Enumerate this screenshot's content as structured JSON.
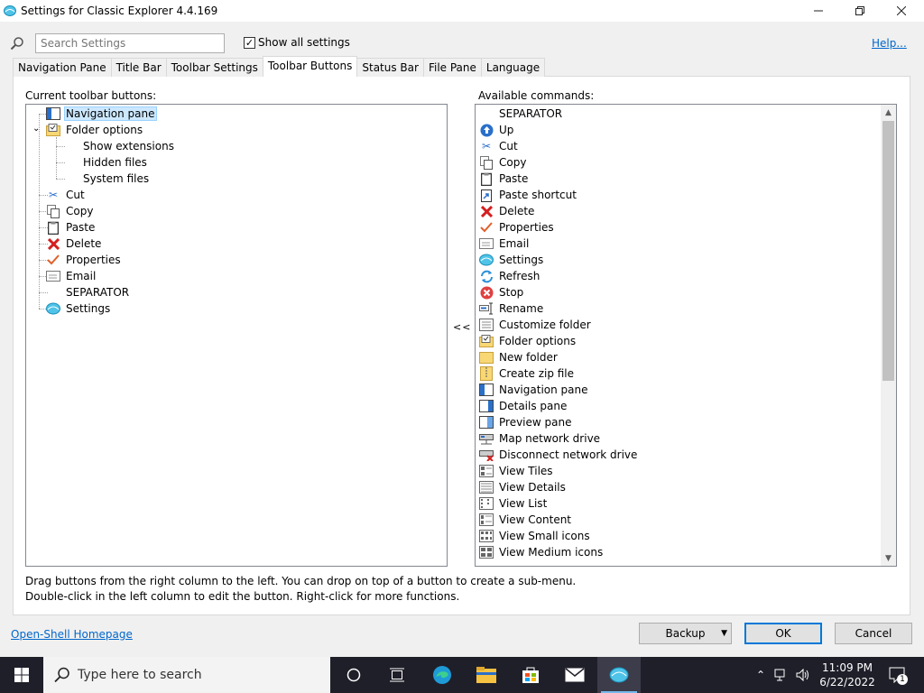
{
  "window": {
    "title": "Settings for Classic Explorer 4.4.169",
    "minimize_icon": "minimize-icon",
    "maximize_icon": "restore-icon",
    "close_icon": "close-icon"
  },
  "search": {
    "placeholder": "Search Settings",
    "value": ""
  },
  "show_all": {
    "label": "Show all settings",
    "checked": true
  },
  "help_link": "Help...",
  "tabs": [
    {
      "label": "Navigation Pane",
      "active": false
    },
    {
      "label": "Title Bar",
      "active": false
    },
    {
      "label": "Toolbar Settings",
      "active": false
    },
    {
      "label": "Toolbar Buttons",
      "active": true
    },
    {
      "label": "Status Bar",
      "active": false
    },
    {
      "label": "File Pane",
      "active": false
    },
    {
      "label": "Language",
      "active": false
    }
  ],
  "left": {
    "label": "Current toolbar buttons:",
    "items": [
      {
        "label": "Navigation pane",
        "icon": "navigation-pane-icon",
        "level": 0,
        "selected": true
      },
      {
        "label": "Folder options",
        "icon": "folder-options-icon",
        "level": 0,
        "expanded": true
      },
      {
        "label": "Show extensions",
        "icon": "",
        "level": 1
      },
      {
        "label": "Hidden files",
        "icon": "",
        "level": 1
      },
      {
        "label": "System files",
        "icon": "",
        "level": 1
      },
      {
        "label": "Cut",
        "icon": "scissors-icon",
        "level": 0
      },
      {
        "label": "Copy",
        "icon": "copy-icon",
        "level": 0
      },
      {
        "label": "Paste",
        "icon": "clipboard-icon",
        "level": 0
      },
      {
        "label": "Delete",
        "icon": "delete-x-icon",
        "level": 0
      },
      {
        "label": "Properties",
        "icon": "checkmark-icon",
        "level": 0
      },
      {
        "label": "Email",
        "icon": "envelope-icon",
        "level": 0
      },
      {
        "label": "SEPARATOR",
        "icon": "",
        "level": 0
      },
      {
        "label": "Settings",
        "icon": "shell-icon",
        "level": 0
      }
    ]
  },
  "move_left": "<<",
  "right": {
    "label": "Available commands:",
    "items": [
      {
        "label": "SEPARATOR",
        "icon": ""
      },
      {
        "label": "Up",
        "icon": "up-arrow-icon"
      },
      {
        "label": "Cut",
        "icon": "scissors-icon"
      },
      {
        "label": "Copy",
        "icon": "copy-icon"
      },
      {
        "label": "Paste",
        "icon": "clipboard-icon"
      },
      {
        "label": "Paste shortcut",
        "icon": "paste-shortcut-icon"
      },
      {
        "label": "Delete",
        "icon": "delete-x-icon"
      },
      {
        "label": "Properties",
        "icon": "checkmark-icon"
      },
      {
        "label": "Email",
        "icon": "envelope-icon"
      },
      {
        "label": "Settings",
        "icon": "shell-icon"
      },
      {
        "label": "Refresh",
        "icon": "refresh-icon"
      },
      {
        "label": "Stop",
        "icon": "stop-icon"
      },
      {
        "label": "Rename",
        "icon": "rename-icon"
      },
      {
        "label": "Customize folder",
        "icon": "customize-folder-icon"
      },
      {
        "label": "Folder options",
        "icon": "folder-options-icon"
      },
      {
        "label": "New folder",
        "icon": "new-folder-icon"
      },
      {
        "label": "Create zip file",
        "icon": "zip-icon"
      },
      {
        "label": "Navigation pane",
        "icon": "navigation-pane-icon"
      },
      {
        "label": "Details pane",
        "icon": "details-pane-icon"
      },
      {
        "label": "Preview pane",
        "icon": "preview-pane-icon"
      },
      {
        "label": "Map network drive",
        "icon": "map-drive-icon"
      },
      {
        "label": "Disconnect network drive",
        "icon": "disconnect-drive-icon"
      },
      {
        "label": "View Tiles",
        "icon": "view-tiles-icon"
      },
      {
        "label": "View Details",
        "icon": "view-details-icon"
      },
      {
        "label": "View List",
        "icon": "view-list-icon"
      },
      {
        "label": "View Content",
        "icon": "view-content-icon"
      },
      {
        "label": "View Small icons",
        "icon": "view-small-icons-icon"
      },
      {
        "label": "View Medium icons",
        "icon": "view-medium-icons-icon"
      }
    ]
  },
  "help_text": {
    "line1": "Drag buttons from the right column to the left. You can drop on top of a button to create a sub-menu.",
    "line2": "Double-click in the left column to edit the button. Right-click for more functions."
  },
  "homepage_link": "Open-Shell Homepage",
  "buttons": {
    "backup": "Backup",
    "ok": "OK",
    "cancel": "Cancel"
  },
  "taskbar": {
    "search_placeholder": "Type here to search",
    "time": "11:09 PM",
    "date": "6/22/2022",
    "notification_count": "1"
  },
  "colors": {
    "accent": "#0078d7",
    "selection": "#cce8ff",
    "link": "#0066cc",
    "taskbar": "#1f1f2a"
  }
}
